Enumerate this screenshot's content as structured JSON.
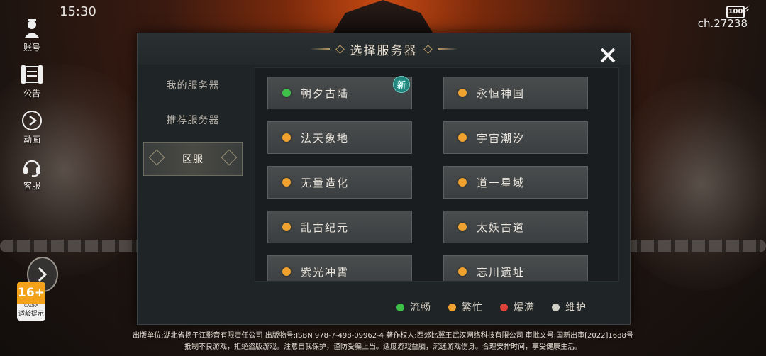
{
  "status_bar": {
    "time": "15:30",
    "battery": "100",
    "channel": "ch.27238"
  },
  "side_menu": [
    {
      "label": "账号",
      "icon": "account-icon"
    },
    {
      "label": "公告",
      "icon": "announcement-icon"
    },
    {
      "label": "动画",
      "icon": "play-icon"
    },
    {
      "label": "客服",
      "icon": "headset-icon"
    }
  ],
  "dialog": {
    "title": "选择服务器",
    "tabs": [
      {
        "label": "我的服务器",
        "active": false
      },
      {
        "label": "推荐服务器",
        "active": false
      },
      {
        "label": "区服",
        "active": true
      }
    ],
    "servers": [
      {
        "name": "朝夕古陆",
        "status": "smooth",
        "new": true
      },
      {
        "name": "永恒神国",
        "status": "busy",
        "new": false
      },
      {
        "name": "法天象地",
        "status": "busy",
        "new": false
      },
      {
        "name": "宇宙潮汐",
        "status": "busy",
        "new": false
      },
      {
        "name": "无量造化",
        "status": "busy",
        "new": false
      },
      {
        "name": "道一星域",
        "status": "busy",
        "new": false
      },
      {
        "name": "乱古纪元",
        "status": "busy",
        "new": false
      },
      {
        "name": "太妖古道",
        "status": "busy",
        "new": false
      },
      {
        "name": "紫光冲霄",
        "status": "busy",
        "new": false
      },
      {
        "name": "忘川遗址",
        "status": "busy",
        "new": false
      }
    ],
    "new_badge": "新",
    "legend": [
      {
        "label": "流畅",
        "color": "#3ec04a"
      },
      {
        "label": "繁忙",
        "color": "#f0a22e"
      },
      {
        "label": "爆满",
        "color": "#e0413a"
      },
      {
        "label": "维护",
        "color": "#cfcfc6"
      }
    ],
    "status_colors": {
      "smooth": "#3ec04a",
      "busy": "#f0a22e",
      "full": "#e0413a",
      "maintenance": "#cfcfc6"
    }
  },
  "age_rating": {
    "age": "16+",
    "org": "CADPA",
    "label": "适龄提示"
  },
  "footer": {
    "line1": "出版单位:湖北省扬子江影音有限责任公司 出版物号:ISBN 978-7-498-09962-4 著作权人:西郊比翼王武汉网络科技有限公司 审批文号:国新出审[2022]1688号",
    "line2": "抵制不良游戏，拒绝盗版游戏。注意自我保护，谨防受骗上当。适度游戏益脑，沉迷游戏伤身。合理安排时间，享受健康生活。"
  }
}
